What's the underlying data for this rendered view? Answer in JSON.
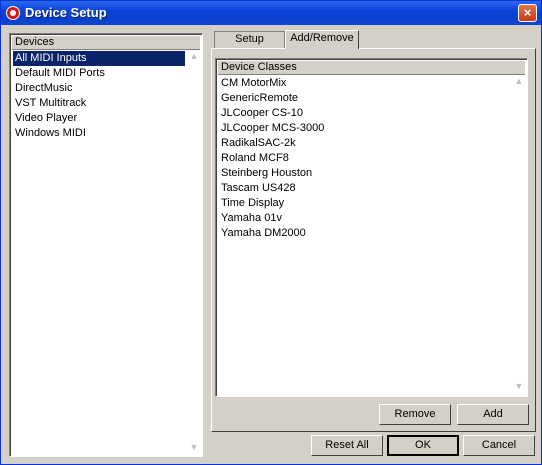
{
  "window": {
    "title": "Device Setup"
  },
  "devices": {
    "header": "Devices",
    "items": [
      "All MIDI Inputs",
      "Default MIDI Ports",
      "DirectMusic",
      "VST Multitrack",
      "Video Player",
      "Windows MIDI"
    ],
    "selected": "All MIDI Inputs"
  },
  "tabs": [
    {
      "label": "Setup",
      "active": false
    },
    {
      "label": "Add/Remove",
      "active": true
    }
  ],
  "device_classes": {
    "header": "Device Classes",
    "items": [
      "CM MotorMix",
      "GenericRemote",
      "JLCooper CS-10",
      "JLCooper MCS-3000",
      "RadikalSAC-2k",
      "Roland MCF8",
      "Steinberg Houston",
      "Tascam US428",
      "Time Display",
      "Yamaha 01v",
      "Yamaha DM2000"
    ]
  },
  "buttons": {
    "remove": "Remove",
    "add": "Add",
    "reset_all": "Reset All",
    "ok": "OK",
    "cancel": "Cancel"
  },
  "icons": {
    "close": "×",
    "scroll_up": "▲",
    "scroll_down": "▼"
  }
}
